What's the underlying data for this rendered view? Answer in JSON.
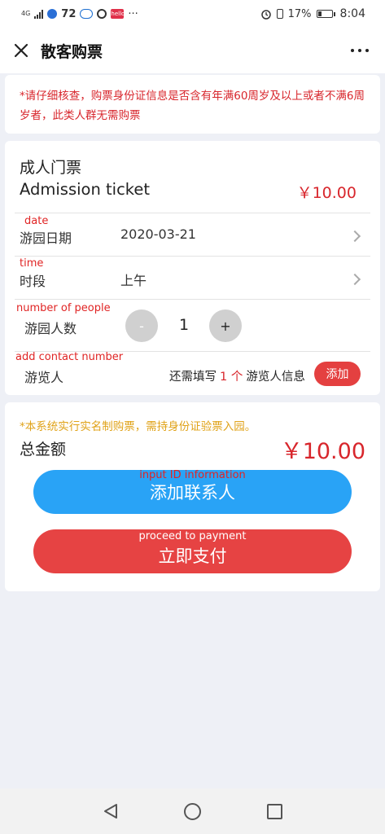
{
  "status_bar": {
    "network": "4G",
    "notification_count": "72",
    "more": "···",
    "app_badge": "hello",
    "battery": "17%",
    "time": "8:04"
  },
  "titlebar": {
    "title": "散客购票"
  },
  "notice": {
    "text": "*请仔细核查，购票身份证信息是否含有年满60周岁及以上或者不满6周岁者，此类人群无需购票"
  },
  "ticket": {
    "name_cn": "成人门票",
    "name_en": "Admission ticket",
    "price": "￥10.00",
    "date_annotation": "date",
    "date_label": "游园日期",
    "date_value": "2020-03-21",
    "time_annotation": "time",
    "time_label": "时段",
    "time_value": "上午",
    "people_annotation": "number of people",
    "people_label": "游园人数",
    "minus_label": "-",
    "quantity": "1",
    "plus_label": "+",
    "contact_annotation": "add contact number",
    "visitor_label": "游览人",
    "need_prefix": "还需填写",
    "need_count": "1 个",
    "need_suffix": "游览人信息",
    "add_label": "添加"
  },
  "summary": {
    "realname_notice": "*本系统实行实名制购票，需持身份证验票入园。",
    "total_label": "总金额",
    "total_amount": "￥10.00",
    "contact_button_annotation": "input ID information",
    "contact_button": "添加联系人",
    "pay_button_annotation": "proceed to payment",
    "pay_button": "立即支付"
  },
  "colors": {
    "accent_red": "#d8262c",
    "button_blue": "#29a3f6",
    "button_red": "#e64343",
    "notice_orange": "#e0a31a"
  },
  "icons": {
    "close": "close-icon",
    "more": "more-icon",
    "chevron": "chevron-right-icon",
    "nav_back": "back-triangle-icon",
    "nav_home": "home-circle-icon",
    "nav_recent": "recent-square-icon"
  }
}
